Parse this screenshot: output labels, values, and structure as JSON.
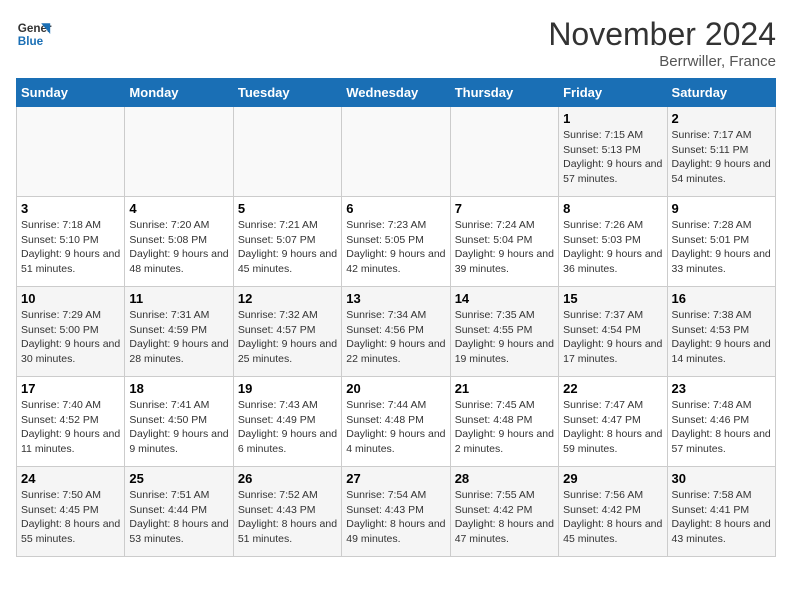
{
  "header": {
    "logo_line1": "General",
    "logo_line2": "Blue",
    "month": "November 2024",
    "location": "Berrwiller, France"
  },
  "weekdays": [
    "Sunday",
    "Monday",
    "Tuesday",
    "Wednesday",
    "Thursday",
    "Friday",
    "Saturday"
  ],
  "weeks": [
    [
      {
        "day": "",
        "info": ""
      },
      {
        "day": "",
        "info": ""
      },
      {
        "day": "",
        "info": ""
      },
      {
        "day": "",
        "info": ""
      },
      {
        "day": "",
        "info": ""
      },
      {
        "day": "1",
        "info": "Sunrise: 7:15 AM\nSunset: 5:13 PM\nDaylight: 9 hours and 57 minutes."
      },
      {
        "day": "2",
        "info": "Sunrise: 7:17 AM\nSunset: 5:11 PM\nDaylight: 9 hours and 54 minutes."
      }
    ],
    [
      {
        "day": "3",
        "info": "Sunrise: 7:18 AM\nSunset: 5:10 PM\nDaylight: 9 hours and 51 minutes."
      },
      {
        "day": "4",
        "info": "Sunrise: 7:20 AM\nSunset: 5:08 PM\nDaylight: 9 hours and 48 minutes."
      },
      {
        "day": "5",
        "info": "Sunrise: 7:21 AM\nSunset: 5:07 PM\nDaylight: 9 hours and 45 minutes."
      },
      {
        "day": "6",
        "info": "Sunrise: 7:23 AM\nSunset: 5:05 PM\nDaylight: 9 hours and 42 minutes."
      },
      {
        "day": "7",
        "info": "Sunrise: 7:24 AM\nSunset: 5:04 PM\nDaylight: 9 hours and 39 minutes."
      },
      {
        "day": "8",
        "info": "Sunrise: 7:26 AM\nSunset: 5:03 PM\nDaylight: 9 hours and 36 minutes."
      },
      {
        "day": "9",
        "info": "Sunrise: 7:28 AM\nSunset: 5:01 PM\nDaylight: 9 hours and 33 minutes."
      }
    ],
    [
      {
        "day": "10",
        "info": "Sunrise: 7:29 AM\nSunset: 5:00 PM\nDaylight: 9 hours and 30 minutes."
      },
      {
        "day": "11",
        "info": "Sunrise: 7:31 AM\nSunset: 4:59 PM\nDaylight: 9 hours and 28 minutes."
      },
      {
        "day": "12",
        "info": "Sunrise: 7:32 AM\nSunset: 4:57 PM\nDaylight: 9 hours and 25 minutes."
      },
      {
        "day": "13",
        "info": "Sunrise: 7:34 AM\nSunset: 4:56 PM\nDaylight: 9 hours and 22 minutes."
      },
      {
        "day": "14",
        "info": "Sunrise: 7:35 AM\nSunset: 4:55 PM\nDaylight: 9 hours and 19 minutes."
      },
      {
        "day": "15",
        "info": "Sunrise: 7:37 AM\nSunset: 4:54 PM\nDaylight: 9 hours and 17 minutes."
      },
      {
        "day": "16",
        "info": "Sunrise: 7:38 AM\nSunset: 4:53 PM\nDaylight: 9 hours and 14 minutes."
      }
    ],
    [
      {
        "day": "17",
        "info": "Sunrise: 7:40 AM\nSunset: 4:52 PM\nDaylight: 9 hours and 11 minutes."
      },
      {
        "day": "18",
        "info": "Sunrise: 7:41 AM\nSunset: 4:50 PM\nDaylight: 9 hours and 9 minutes."
      },
      {
        "day": "19",
        "info": "Sunrise: 7:43 AM\nSunset: 4:49 PM\nDaylight: 9 hours and 6 minutes."
      },
      {
        "day": "20",
        "info": "Sunrise: 7:44 AM\nSunset: 4:48 PM\nDaylight: 9 hours and 4 minutes."
      },
      {
        "day": "21",
        "info": "Sunrise: 7:45 AM\nSunset: 4:48 PM\nDaylight: 9 hours and 2 minutes."
      },
      {
        "day": "22",
        "info": "Sunrise: 7:47 AM\nSunset: 4:47 PM\nDaylight: 8 hours and 59 minutes."
      },
      {
        "day": "23",
        "info": "Sunrise: 7:48 AM\nSunset: 4:46 PM\nDaylight: 8 hours and 57 minutes."
      }
    ],
    [
      {
        "day": "24",
        "info": "Sunrise: 7:50 AM\nSunset: 4:45 PM\nDaylight: 8 hours and 55 minutes."
      },
      {
        "day": "25",
        "info": "Sunrise: 7:51 AM\nSunset: 4:44 PM\nDaylight: 8 hours and 53 minutes."
      },
      {
        "day": "26",
        "info": "Sunrise: 7:52 AM\nSunset: 4:43 PM\nDaylight: 8 hours and 51 minutes."
      },
      {
        "day": "27",
        "info": "Sunrise: 7:54 AM\nSunset: 4:43 PM\nDaylight: 8 hours and 49 minutes."
      },
      {
        "day": "28",
        "info": "Sunrise: 7:55 AM\nSunset: 4:42 PM\nDaylight: 8 hours and 47 minutes."
      },
      {
        "day": "29",
        "info": "Sunrise: 7:56 AM\nSunset: 4:42 PM\nDaylight: 8 hours and 45 minutes."
      },
      {
        "day": "30",
        "info": "Sunrise: 7:58 AM\nSunset: 4:41 PM\nDaylight: 8 hours and 43 minutes."
      }
    ]
  ]
}
